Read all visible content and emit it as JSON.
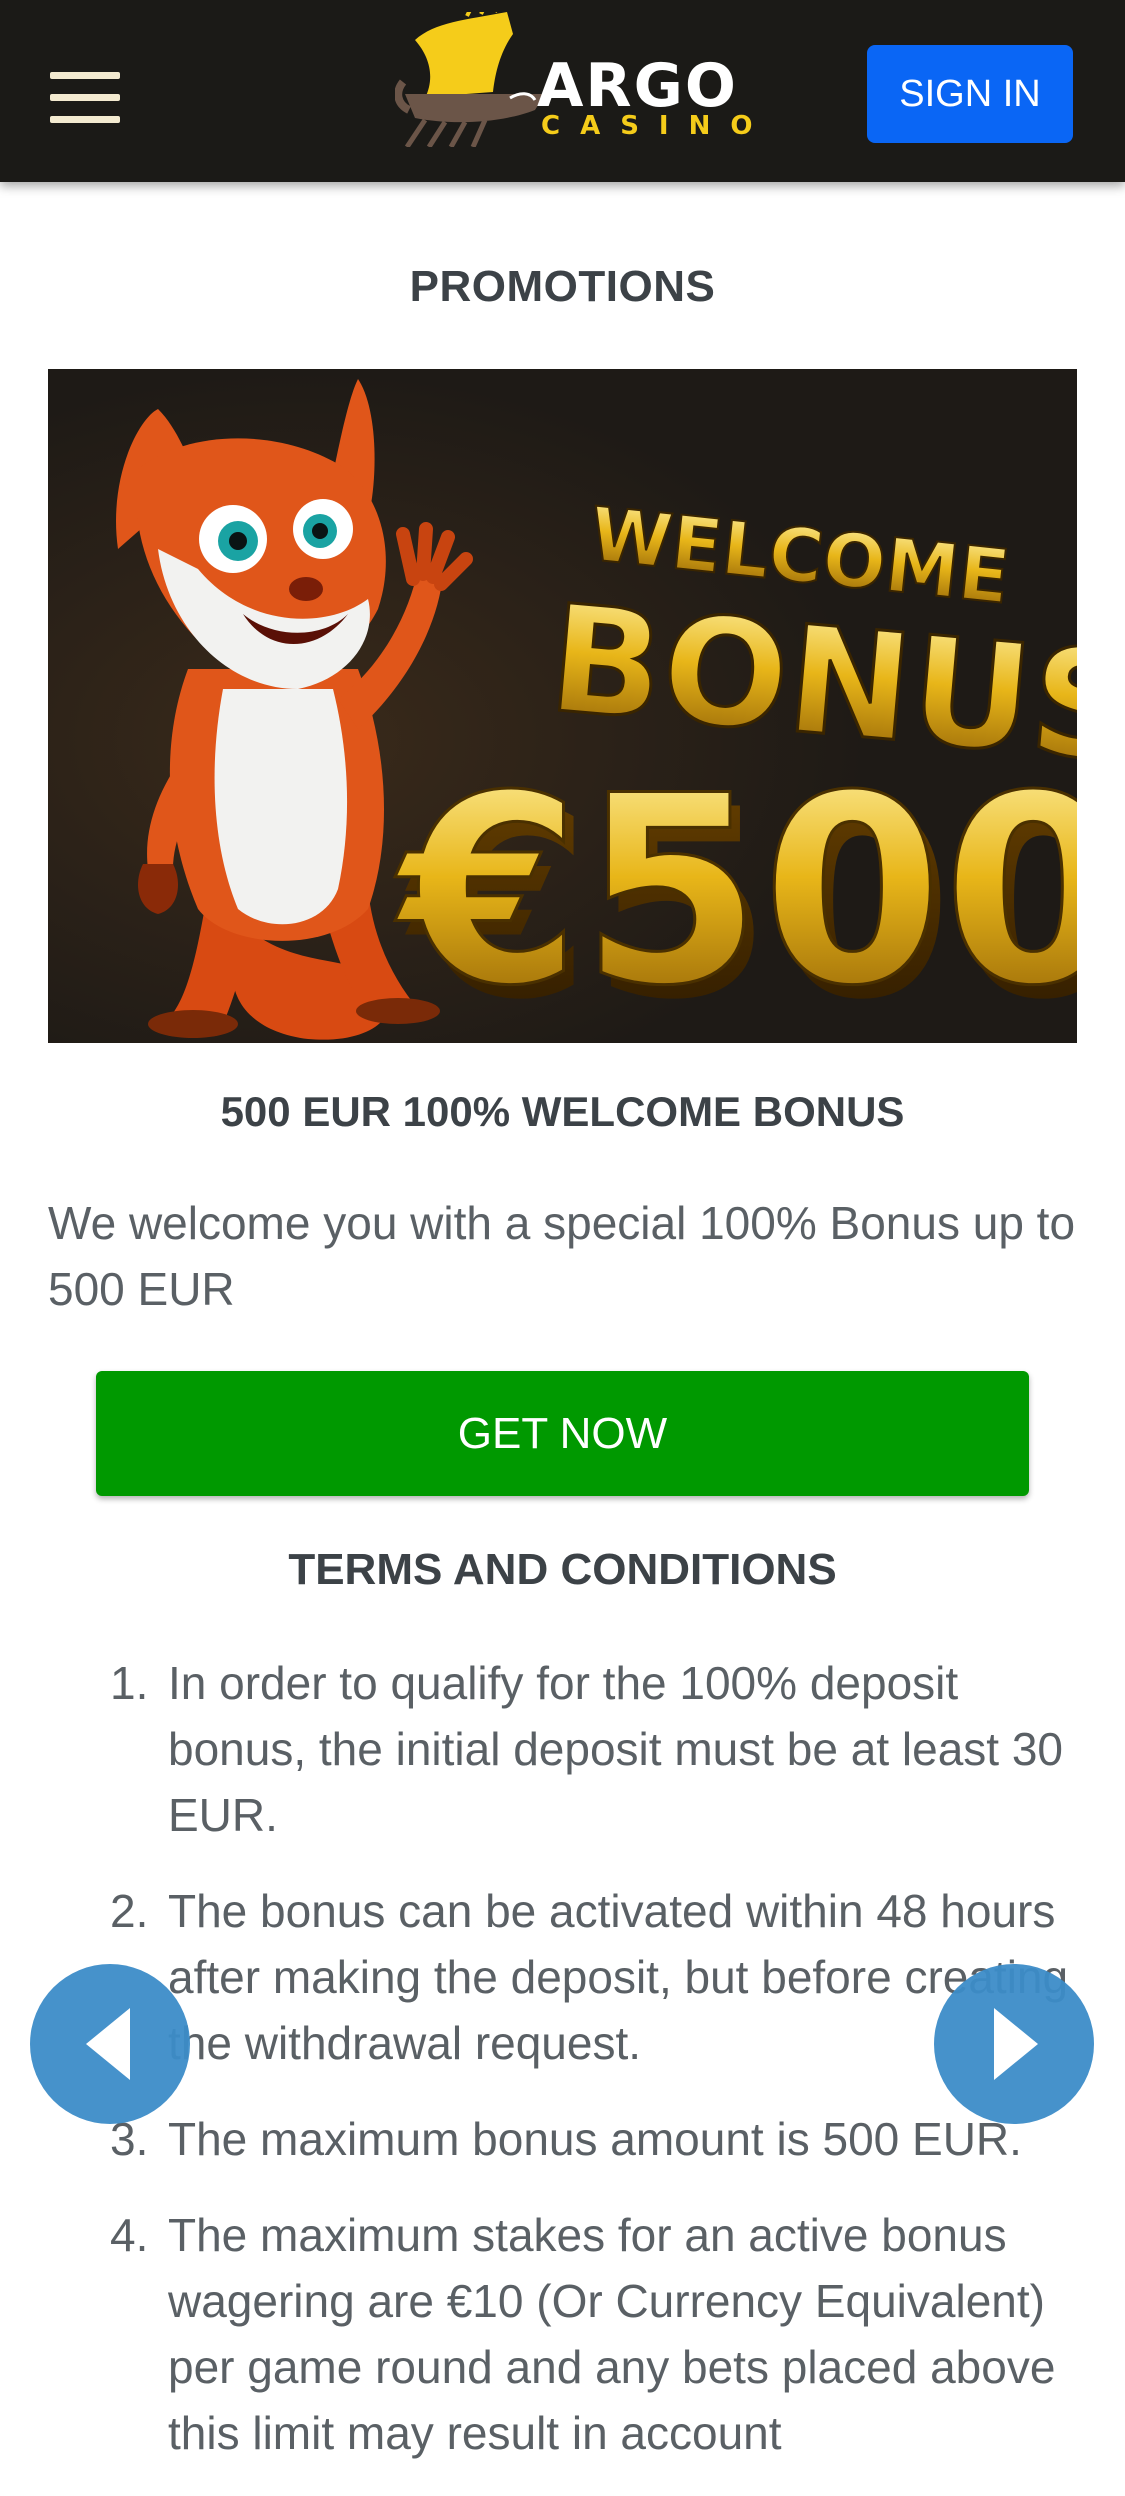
{
  "header": {
    "logo_line1": "ARGO",
    "logo_line2": "CASINO",
    "signin_label": "SIGN IN",
    "menu_icon": "hamburger-icon"
  },
  "page_title": "PROMOTIONS",
  "banner": {
    "line1": "WELCOME",
    "line2": "BONUS",
    "amount": "€500"
  },
  "promo": {
    "title": "500 EUR 100% WELCOME BONUS",
    "description": "We welcome you with a special 100% Bonus up to 500 EUR",
    "cta_label": "GET NOW"
  },
  "terms": {
    "title": "TERMS AND CONDITIONS",
    "items": [
      {
        "num": "1.",
        "text": "In order to qualify for the 100% deposit bonus, the initial deposit must be at least 30 EUR."
      },
      {
        "num": "2.",
        "text": "The bonus can be activated within 48 hours after making the deposit, but before creating the withdrawal request."
      },
      {
        "num": "3.",
        "text": "The maximum bonus amount is 500 EUR."
      },
      {
        "num": "4.",
        "text": "The maximum stakes for an active bonus wagering are €10 (Or Currency Equivalent) per game round and any bets placed above this limit may result in account"
      }
    ]
  },
  "nav": {
    "prev_icon": "arrow-left-icon",
    "next_icon": "arrow-right-icon"
  },
  "colors": {
    "header_bg": "#1b1a17",
    "signin_bg": "#0a66f5",
    "cta_bg": "#009900",
    "brand_yellow": "#f5cc1a",
    "nav_arrow": "#3c8cc8"
  }
}
